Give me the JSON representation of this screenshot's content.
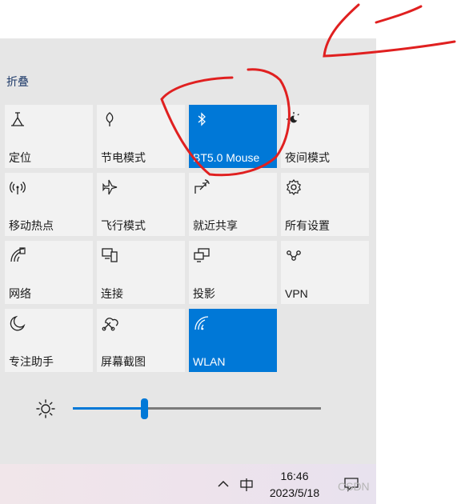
{
  "panel": {
    "collapse_label": "折叠"
  },
  "tiles": [
    {
      "label": "定位",
      "icon": "location-icon",
      "on": false
    },
    {
      "label": "节电模式",
      "icon": "leaf-icon",
      "on": false
    },
    {
      "label": "BT5.0 Mouse",
      "icon": "bluetooth-icon",
      "on": true
    },
    {
      "label": "夜间模式",
      "icon": "night-light-icon",
      "on": false
    },
    {
      "label": "移动热点",
      "icon": "hotspot-icon",
      "on": false
    },
    {
      "label": "飞行模式",
      "icon": "airplane-icon",
      "on": false
    },
    {
      "label": "就近共享",
      "icon": "share-icon",
      "on": false
    },
    {
      "label": "所有设置",
      "icon": "gear-icon",
      "on": false
    },
    {
      "label": "网络",
      "icon": "network-icon",
      "on": false
    },
    {
      "label": "连接",
      "icon": "connect-icon",
      "on": false
    },
    {
      "label": "投影",
      "icon": "project-icon",
      "on": false
    },
    {
      "label": "VPN",
      "icon": "vpn-icon",
      "on": false
    },
    {
      "label": "专注助手",
      "icon": "moon-icon",
      "on": false
    },
    {
      "label": "屏幕截图",
      "icon": "snip-icon",
      "on": false
    },
    {
      "label": "WLAN",
      "icon": "wifi-icon",
      "on": true
    }
  ],
  "brightness": {
    "icon": "sun-icon",
    "level_percent": 29
  },
  "taskbar": {
    "time": "16:46",
    "date": "2023/5/18",
    "icons": [
      "chevron-up-icon",
      "ime-icon",
      "notification-icon"
    ]
  },
  "watermark": "CSDN",
  "colors": {
    "accent": "#0078d7",
    "tile": "#f2f2f2",
    "panel": "#e6e6e6",
    "annotation": "#e02020"
  }
}
